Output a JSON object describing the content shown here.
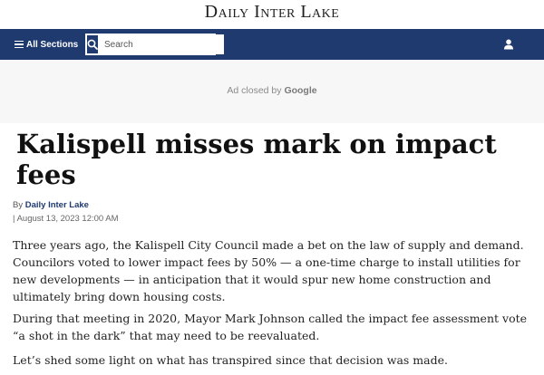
{
  "masthead": {
    "logo": "Daily Inter Lake"
  },
  "nav": {
    "sections_label": "All Sections",
    "search_placeholder": "Search"
  },
  "ad": {
    "closed_label": "Ad closed by",
    "brand": "Google"
  },
  "article": {
    "headline": "Kalispell misses mark on impact fees",
    "byline_prefix": "By",
    "author": "Daily Inter Lake",
    "date": "| August 13, 2023 12:00 AM",
    "paragraphs": [
      "Three years ago, the Kalispell City Council made a bet on the law of supply and demand. Councilors voted to lower impact fees by 50% — a one-time charge to install utilities for new developments — in anticipation that it would spur new home construction and ultimately bring down housing costs.",
      "During that meeting in 2020, Mayor Mark Johnson called the impact fee assessment vote “a shot in the dark” that may need to be reevaluated.",
      "Let’s shed some light on what has transpired since that decision was made."
    ]
  },
  "colors": {
    "nav_bg": "#1f3a6e",
    "ad_bg": "#f7f7f7"
  }
}
